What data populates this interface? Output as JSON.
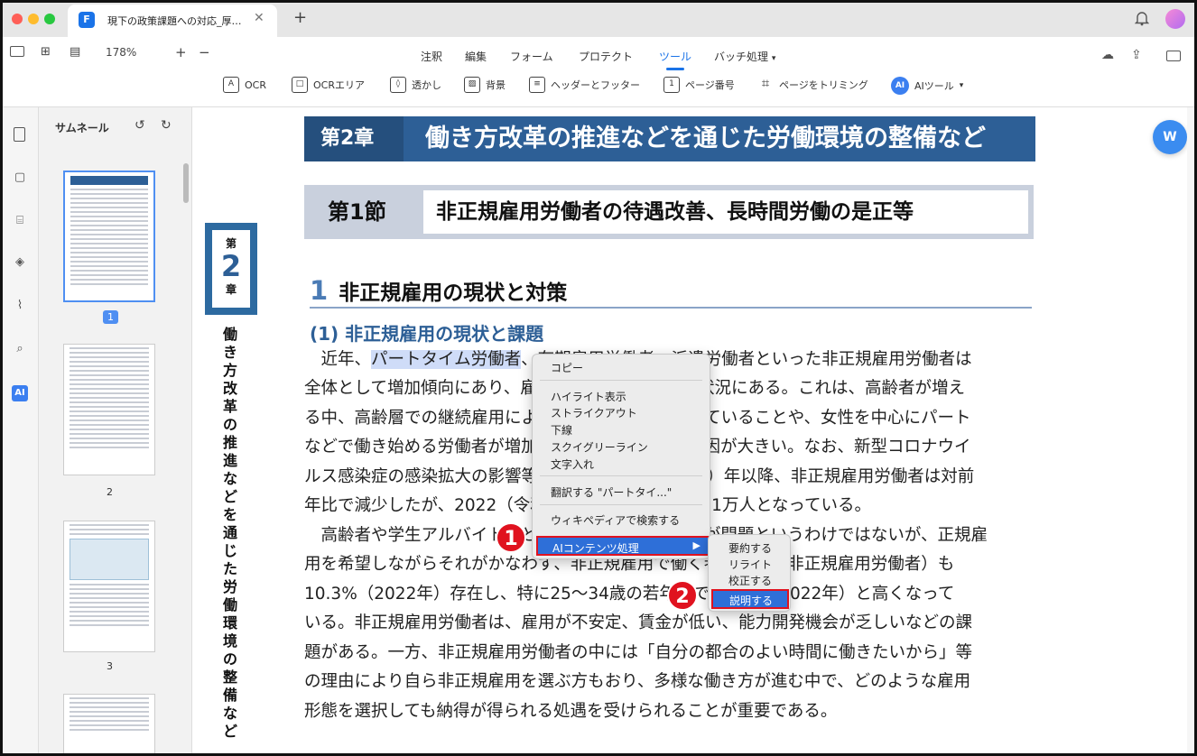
{
  "window": {
    "tab_title": "現下の政策課題への対応_厚…",
    "tab_close": "✕",
    "new_tab": "+",
    "logo": "F"
  },
  "toolbar": {
    "zoom": "178%",
    "zoom_plus": "+",
    "zoom_minus": "−",
    "menus": [
      "注釈",
      "編集",
      "フォーム",
      "プロテクト",
      "ツール",
      "バッチ処理"
    ],
    "active_menu": "ツール",
    "tools": [
      {
        "label": "OCR",
        "icon": "A"
      },
      {
        "label": "OCRエリア",
        "icon": "□"
      },
      {
        "label": "透かし",
        "icon": "◊"
      },
      {
        "label": "背景",
        "icon": "▨"
      },
      {
        "label": "ヘッダーとフッター",
        "icon": "≡"
      },
      {
        "label": "ページ番号",
        "icon": "1"
      },
      {
        "label": "ページをトリミング",
        "icon": "⌗"
      },
      {
        "label": "AIツール",
        "icon": "AI"
      }
    ]
  },
  "rail": {
    "ai_label": "AI"
  },
  "thumbnails": {
    "header": "サムネール",
    "pages": [
      "1",
      "2",
      "3"
    ]
  },
  "document": {
    "side_tab": {
      "top": "第",
      "num": "2",
      "bottom": "章"
    },
    "side_vertical": "働き方改革の推進などを通じた労働環境の整備など",
    "chapter_label": "第2章",
    "chapter_title": "働き方改革の推進などを通じた労働環境の整備など",
    "section_label": "第1節",
    "section_title": "非正規雇用労働者の待遇改善、長時間労働の是正等",
    "heading_num": "1",
    "heading": "非正規雇用の現状と対策",
    "subheading": "(1) 非正規雇用の現状と課題",
    "p1_lead": "近年、",
    "p1_highlight": "パートタイム労働者",
    "p1_rest": "、有期雇用労働者、派遣労働者といった非正規雇用労働者は",
    "lines": [
      "全体として増加傾向にあり、雇用者の約4割を占める状況にある。これは、高齢者が増え",
      "る中、高齢層での継続雇用により非正規雇用が増加していることや、女性を中心にパート",
      "などで働き始める労働者が増加していることなどの要因が大きい。なお、新型コロナウイ",
      "ルス感染症の感染拡大の影響等により、2020（令和2）年以降、非正規雇用労働者は対前",
      "年比で減少したが、2022（令和4）年は増加し、2,101万人となっている。",
      "　高齢者や学生アルバイトなど、非正規雇用そのものが問題というわけではないが、正規雇",
      "用を希望しながらそれがかなわず、非正規雇用で働く者（不本意非正規雇用労働者）も",
      "10.3%（2022年）存在し、特に25〜34歳の若年層で15.5%（2022年）と高くなって",
      "いる。非正規雇用労働者は、雇用が不安定、賃金が低い、能力開発機会が乏しいなどの課",
      "題がある。一方、非正規雇用労働者の中には「自分の都合のよい時間に働きたいから」等",
      "の理由により自ら非正規雇用を選ぶ方もおり、多様な働き方が進む中で、どのような雇用",
      "形態を選択しても納得が得られる処遇を受けられることが重要である。"
    ]
  },
  "context_menu": {
    "copy": "コピー",
    "highlight": "ハイライト表示",
    "strikeout": "ストライクアウト",
    "underline": "下線",
    "squiggly": "スクイグリーライン",
    "text": "文字入れ",
    "translate": "翻訳する \"パートタイ...\"",
    "wiki": "ウィキペディアで検索する",
    "ai": "AIコンテンツ処理",
    "ai_arrow": "▶"
  },
  "submenu": {
    "summarize": "要約する",
    "rewrite": "リライト",
    "proofread": "校正する",
    "explain": "説明する"
  },
  "badges": [
    "1",
    "2"
  ],
  "float_btn": "W"
}
